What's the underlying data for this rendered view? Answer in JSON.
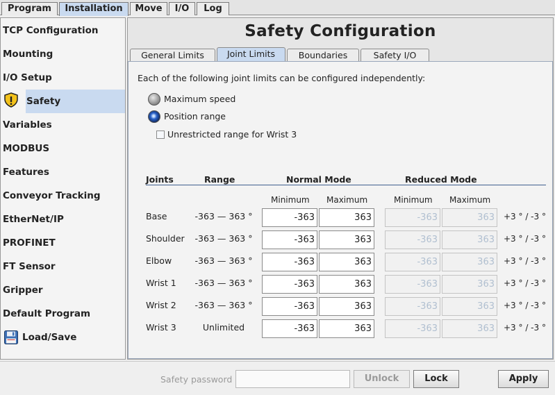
{
  "top_tabs": [
    {
      "label": "Program"
    },
    {
      "label": "Installation"
    },
    {
      "label": "Move"
    },
    {
      "label": "I/O"
    },
    {
      "label": "Log"
    }
  ],
  "active_top_tab": "Installation",
  "sidebar": {
    "items": [
      {
        "label": "TCP Configuration"
      },
      {
        "label": "Mounting"
      },
      {
        "label": "I/O Setup"
      },
      {
        "label": "Safety",
        "icon": "warning-shield-icon"
      },
      {
        "label": "Variables"
      },
      {
        "label": "MODBUS"
      },
      {
        "label": "Features"
      },
      {
        "label": "Conveyor Tracking"
      },
      {
        "label": "EtherNet/IP"
      },
      {
        "label": "PROFINET"
      },
      {
        "label": "FT Sensor"
      },
      {
        "label": "Gripper"
      },
      {
        "label": "Default Program"
      },
      {
        "label": "Load/Save",
        "icon": "floppy-disk-icon"
      }
    ],
    "active": "Safety"
  },
  "main": {
    "title": "Safety Configuration",
    "tabs": [
      {
        "label": "General Limits"
      },
      {
        "label": "Joint Limits"
      },
      {
        "label": "Boundaries"
      },
      {
        "label": "Safety I/O"
      }
    ],
    "active_tab": "Joint Limits",
    "description": "Each of the following joint limits can be configured independently:",
    "options": {
      "max_speed": "Maximum speed",
      "position_range": "Position range",
      "selected": "Position range",
      "unrestricted_label": "Unrestricted range for Wrist 3",
      "unrestricted_checked": false
    },
    "table": {
      "headers": {
        "joints": "Joints",
        "range": "Range",
        "normal": "Normal Mode",
        "reduced": "Reduced Mode",
        "minimum": "Minimum",
        "maximum": "Maximum"
      },
      "rows": [
        {
          "joint": "Base",
          "range": "-363 — 363 °",
          "normal_min": "-363",
          "normal_max": "363",
          "reduced_min": "-363",
          "reduced_max": "363",
          "tolerance": "+3 ° / -3 °"
        },
        {
          "joint": "Shoulder",
          "range": "-363 — 363 °",
          "normal_min": "-363",
          "normal_max": "363",
          "reduced_min": "-363",
          "reduced_max": "363",
          "tolerance": "+3 ° / -3 °"
        },
        {
          "joint": "Elbow",
          "range": "-363 — 363 °",
          "normal_min": "-363",
          "normal_max": "363",
          "reduced_min": "-363",
          "reduced_max": "363",
          "tolerance": "+3 ° / -3 °"
        },
        {
          "joint": "Wrist 1",
          "range": "-363 — 363 °",
          "normal_min": "-363",
          "normal_max": "363",
          "reduced_min": "-363",
          "reduced_max": "363",
          "tolerance": "+3 ° / -3 °"
        },
        {
          "joint": "Wrist 2",
          "range": "-363 — 363 °",
          "normal_min": "-363",
          "normal_max": "363",
          "reduced_min": "-363",
          "reduced_max": "363",
          "tolerance": "+3 ° / -3 °"
        },
        {
          "joint": "Wrist 3",
          "range": "Unlimited",
          "normal_min": "-363",
          "normal_max": "363",
          "reduced_min": "-363",
          "reduced_max": "363",
          "tolerance": "+3 ° / -3 °"
        }
      ]
    }
  },
  "footer": {
    "password_label": "Safety password",
    "password_value": "",
    "unlock_label": "Unlock",
    "lock_label": "Lock",
    "apply_label": "Apply"
  }
}
